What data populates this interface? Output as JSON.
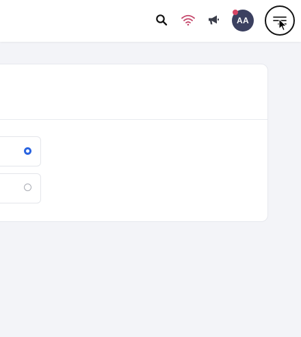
{
  "header": {
    "avatar_initials": "AA",
    "icons": {
      "search": "search-icon",
      "signal": "wifi-icon",
      "announcements": "megaphone-icon",
      "menu": "hamburger-menu-icon"
    },
    "notification_dot_color": "#d64565",
    "signal_color": "#c44569",
    "avatar_color": "#3b4060"
  },
  "options": {
    "items": [
      {
        "selected": true
      },
      {
        "selected": false
      }
    ]
  },
  "colors": {
    "accent": "#2a64e0",
    "background": "#f3f4f8"
  }
}
